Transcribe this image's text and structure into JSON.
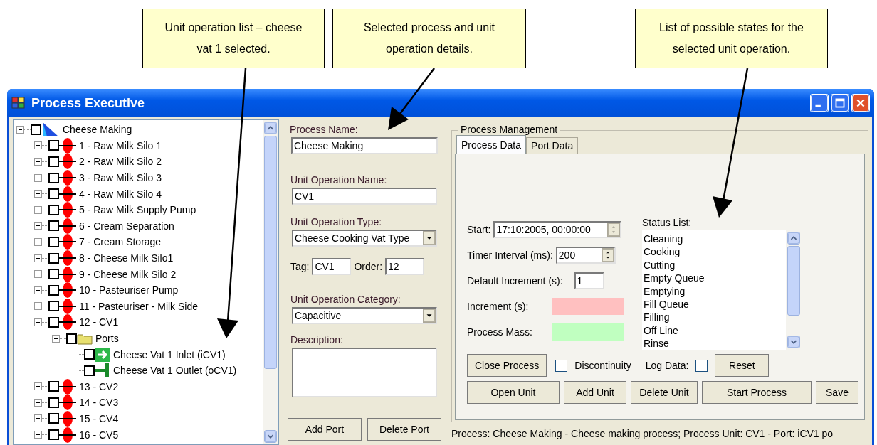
{
  "callouts": [
    {
      "text": "Unit operation list – cheese vat 1 selected."
    },
    {
      "text": "Selected process and unit operation details."
    },
    {
      "text": "List of possible states for the selected unit operation."
    }
  ],
  "window": {
    "title": "Process Executive"
  },
  "tree": [
    {
      "label": "Cheese Making",
      "kind": "process",
      "expanded": true,
      "checked": false,
      "children": [
        {
          "label": "1 - Raw Milk Silo 1",
          "kind": "unit",
          "expanded": false,
          "checked": false
        },
        {
          "label": "2 - Raw Milk Silo 2",
          "kind": "unit",
          "expanded": false,
          "checked": false
        },
        {
          "label": "3 - Raw Milk Silo 3",
          "kind": "unit",
          "expanded": false,
          "checked": false
        },
        {
          "label": "4 - Raw Milk Silo 4",
          "kind": "unit",
          "expanded": false,
          "checked": false
        },
        {
          "label": "5 - Raw Milk Supply Pump",
          "kind": "unit",
          "expanded": false,
          "checked": false
        },
        {
          "label": "6 - Cream Separation",
          "kind": "unit",
          "expanded": false,
          "checked": false
        },
        {
          "label": "7 - Cream Storage",
          "kind": "unit",
          "expanded": false,
          "checked": false
        },
        {
          "label": "8 - Cheese Milk Silo1",
          "kind": "unit",
          "expanded": false,
          "checked": false
        },
        {
          "label": "9 - Cheese Milk Silo 2",
          "kind": "unit",
          "expanded": false,
          "checked": false
        },
        {
          "label": "10 - Pasteuriser Pump",
          "kind": "unit",
          "expanded": false,
          "checked": false
        },
        {
          "label": "11 - Pasteuriser - Milk Side",
          "kind": "unit",
          "expanded": false,
          "checked": false
        },
        {
          "label": "12 - CV1",
          "kind": "unit",
          "expanded": true,
          "checked": false,
          "children": [
            {
              "label": "Ports",
              "kind": "folder",
              "expanded": true,
              "checked": false,
              "children": [
                {
                  "label": "Cheese Vat 1 Inlet (iCV1)",
                  "kind": "inlet",
                  "checked": false
                },
                {
                  "label": "Cheese Vat 1 Outlet (oCV1)",
                  "kind": "outlet",
                  "checked": false
                }
              ]
            }
          ]
        },
        {
          "label": "13 - CV2",
          "kind": "unit",
          "expanded": false,
          "checked": false
        },
        {
          "label": "14 - CV3",
          "kind": "unit",
          "expanded": false,
          "checked": false
        },
        {
          "label": "15 - CV4",
          "kind": "unit",
          "expanded": false,
          "checked": false
        },
        {
          "label": "16 - CV5",
          "kind": "unit",
          "expanded": false,
          "checked": false
        }
      ]
    }
  ],
  "details": {
    "process_name_label": "Process Name:",
    "process_name": "Cheese Making",
    "unit_name_label": "Unit Operation Name:",
    "unit_name": "CV1",
    "unit_type_label": "Unit Operation Type:",
    "unit_type": "Cheese Cooking Vat Type",
    "tag_label": "Tag:",
    "tag": "CV1",
    "order_label": "Order:",
    "order": "12",
    "category_label": "Unit Operation Category:",
    "category": "Capacitive",
    "description_label": "Description:",
    "buttons": [
      "Add Port",
      "Delete Port"
    ]
  },
  "management": {
    "title": "Process Management",
    "tabs": [
      {
        "label": "Process Data",
        "selected": true
      },
      {
        "label": "Port Data",
        "selected": false
      }
    ],
    "start_label": "Start:",
    "start": "17:10:2005, 00:00:00",
    "timer_label": "Timer Interval (ms):",
    "timer": "200",
    "increment_label": "Default Increment (s):",
    "increment": "1",
    "indicators": [
      {
        "label": "Increment (s):",
        "color": "#ffc0c0"
      },
      {
        "label": "Process Mass:",
        "color": "#c0ffc0"
      }
    ],
    "status_list_label": "Status List:",
    "status_list": [
      "Cleaning",
      "Cooking",
      "Cutting",
      "Empty Queue",
      "Emptying",
      "Fill Queue",
      "Filling",
      "Off Line",
      "Rinse"
    ],
    "close_button": "Close Process",
    "discontinuity": {
      "label": "Discontinuity",
      "checked": false
    },
    "log_data": {
      "label": "Log Data:",
      "checked": false
    },
    "reset_button": "Reset",
    "buttons": [
      "Open Unit",
      "Add Unit",
      "Delete Unit",
      "Start Process",
      "Save"
    ]
  },
  "status_bar": "Process: Cheese Making - Cheese making process; Process Unit: CV1 - Port: iCV1 po"
}
